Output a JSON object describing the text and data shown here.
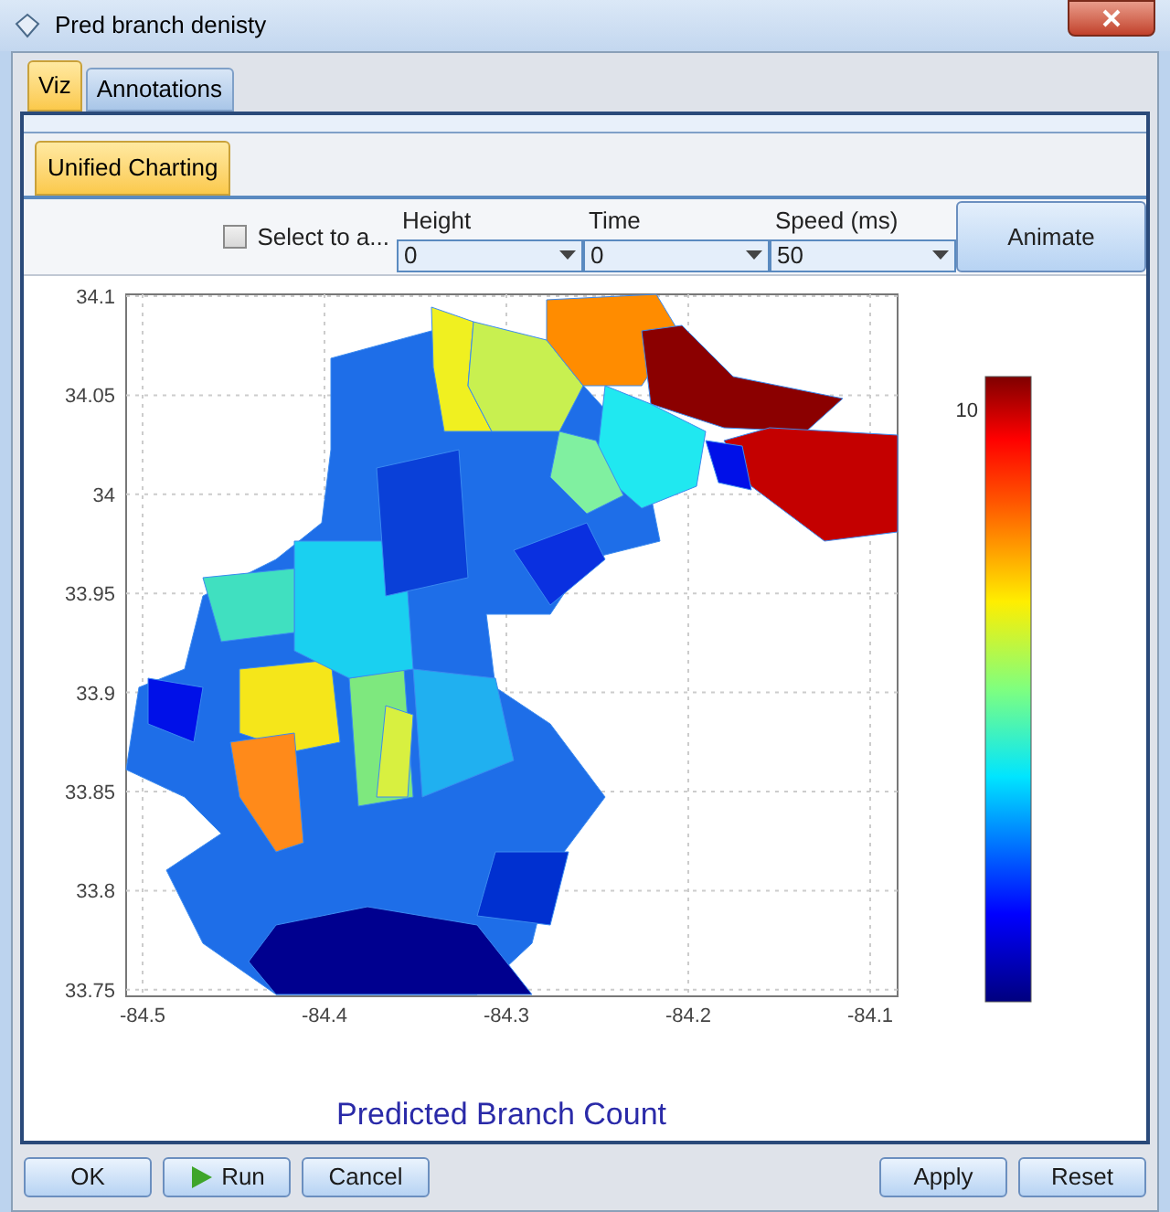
{
  "window": {
    "title": "Pred branch denisty"
  },
  "tabs": [
    {
      "label": "Viz",
      "selected": true
    },
    {
      "label": "Annotations",
      "selected": false
    }
  ],
  "subtabs": [
    {
      "label": "Unified Charting",
      "selected": true
    }
  ],
  "toolbar": {
    "checkbox": {
      "label": "Select to a...",
      "checked": false
    },
    "dropdowns": [
      {
        "label": "Height",
        "value": "0"
      },
      {
        "label": "Time",
        "value": "0"
      },
      {
        "label": "Speed (ms)",
        "value": "50"
      }
    ],
    "button": "Animate"
  },
  "map": {
    "y_ticks": [
      "34.1",
      "34.05",
      "34",
      "33.95",
      "33.9",
      "33.85",
      "33.8",
      "33.75"
    ],
    "x_ticks": [
      "-84.5",
      "-84.4",
      "-84.3",
      "-84.2",
      "-84.1"
    ],
    "colorbar_tick": "10",
    "caption": "Predicted Branch Count"
  },
  "left_buttons": [
    {
      "label": "OK",
      "kind": "plain"
    },
    {
      "label": "Run",
      "kind": "play"
    },
    {
      "label": "Cancel",
      "kind": "plain"
    }
  ],
  "right_buttons": [
    {
      "label": "Apply"
    },
    {
      "label": "Reset"
    }
  ]
}
